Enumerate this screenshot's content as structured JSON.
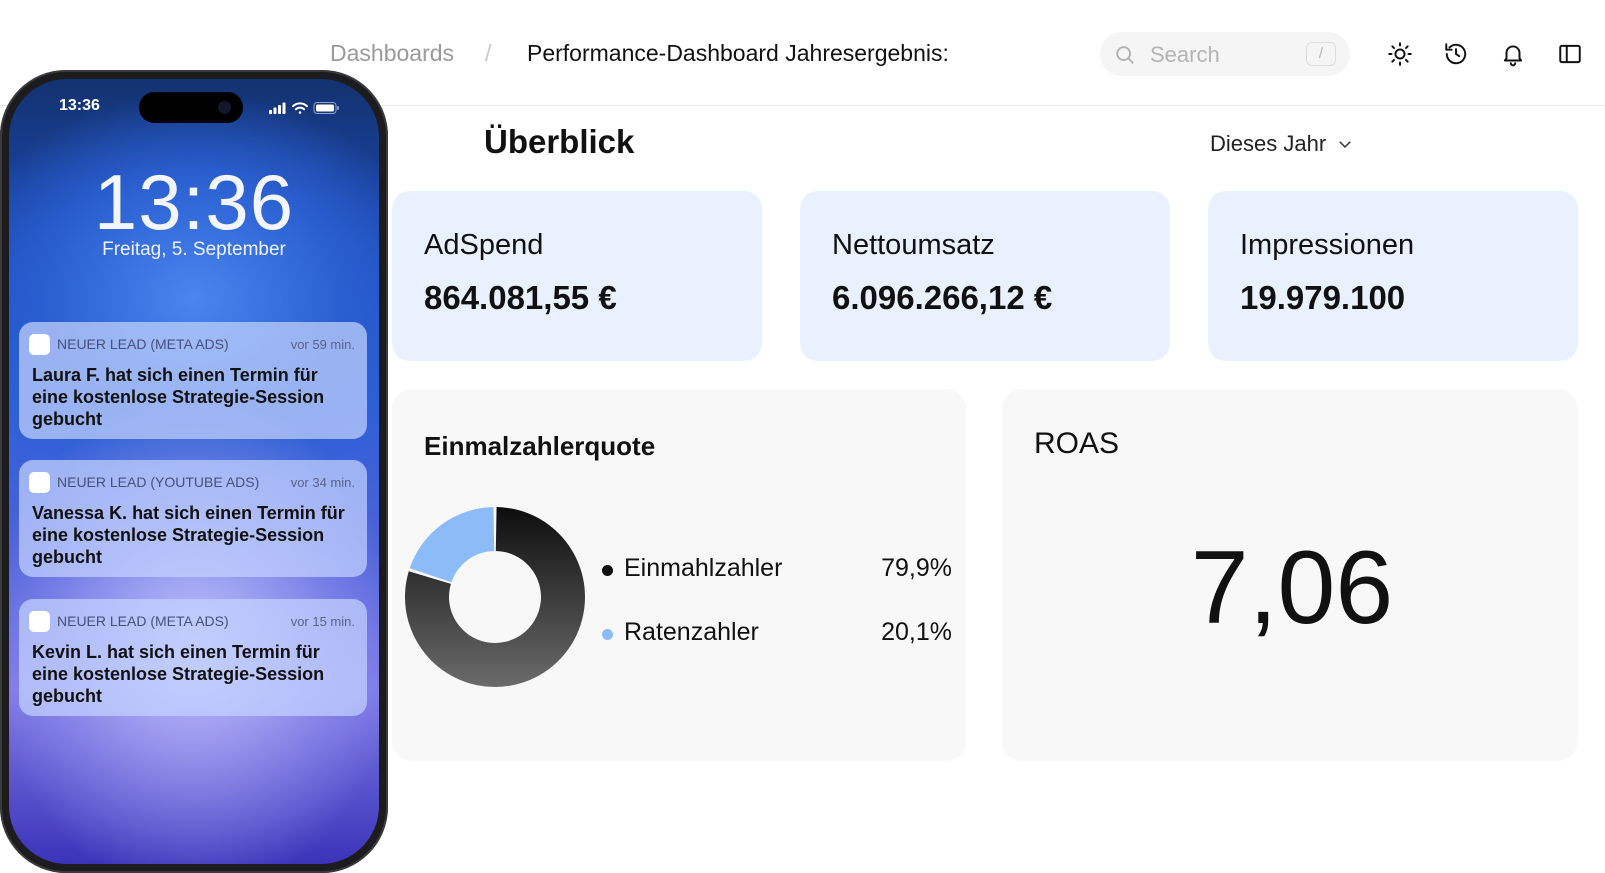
{
  "header": {
    "breadcrumb_root": "Dashboards",
    "breadcrumb_separator": "/",
    "breadcrumb_current": "Performance-Dashboard Jahresergebnis:",
    "search_placeholder": "Search",
    "search_shortcut": "/",
    "icons": [
      "sun-icon",
      "history-icon",
      "bell-icon",
      "sidebar-panel-icon"
    ]
  },
  "overview": {
    "title": "Überblick",
    "period_label": "Dieses Jahr"
  },
  "kpis": [
    {
      "label": "AdSpend",
      "value": "864.081,55 €"
    },
    {
      "label": "Nettoumsatz",
      "value": "6.096.266,12 €"
    },
    {
      "label": "Impressionen",
      "value": "19.979.100"
    }
  ],
  "einmalzahler_card": {
    "title": "Einmalzahlerquote",
    "legend": [
      {
        "name": "Einmahlzahler",
        "value": "79,9%"
      },
      {
        "name": "Ratenzahler",
        "value": "20,1%"
      }
    ]
  },
  "chart_data": {
    "type": "pie",
    "title": "Einmalzahlerquote",
    "categories": [
      "Einmahlzahler",
      "Ratenzahler"
    ],
    "values": [
      79.9,
      20.1
    ],
    "colors": [
      "#111111",
      "#8cbcf7"
    ],
    "donut": true,
    "legend": "right"
  },
  "roas_card": {
    "title": "ROAS",
    "value": "7,06"
  },
  "phone": {
    "status_time": "13:36",
    "lock_time": "13:36",
    "lock_date": "Freitag, 5. September",
    "notifications": [
      {
        "app": "NEUER LEAD (META ADS)",
        "time": "vor 59 min.",
        "body": "Laura F. hat sich einen Termin für eine kostenlose Strategie-Session gebucht"
      },
      {
        "app": "NEUER LEAD (YOUTUBE ADS)",
        "time": "vor 34 min.",
        "body": "Vanessa K. hat sich einen Termin für eine kostenlose Strategie-Session gebucht"
      },
      {
        "app": "NEUER LEAD (META ADS)",
        "time": "vor 15 min.",
        "body": "Kevin L. hat sich einen Termin für eine kostenlose Strategie-Session gebucht"
      }
    ]
  },
  "colors": {
    "kpi_background": "#e8f1fd",
    "card_background": "#f8f8f8",
    "accent_blue": "#8cbcf7"
  }
}
